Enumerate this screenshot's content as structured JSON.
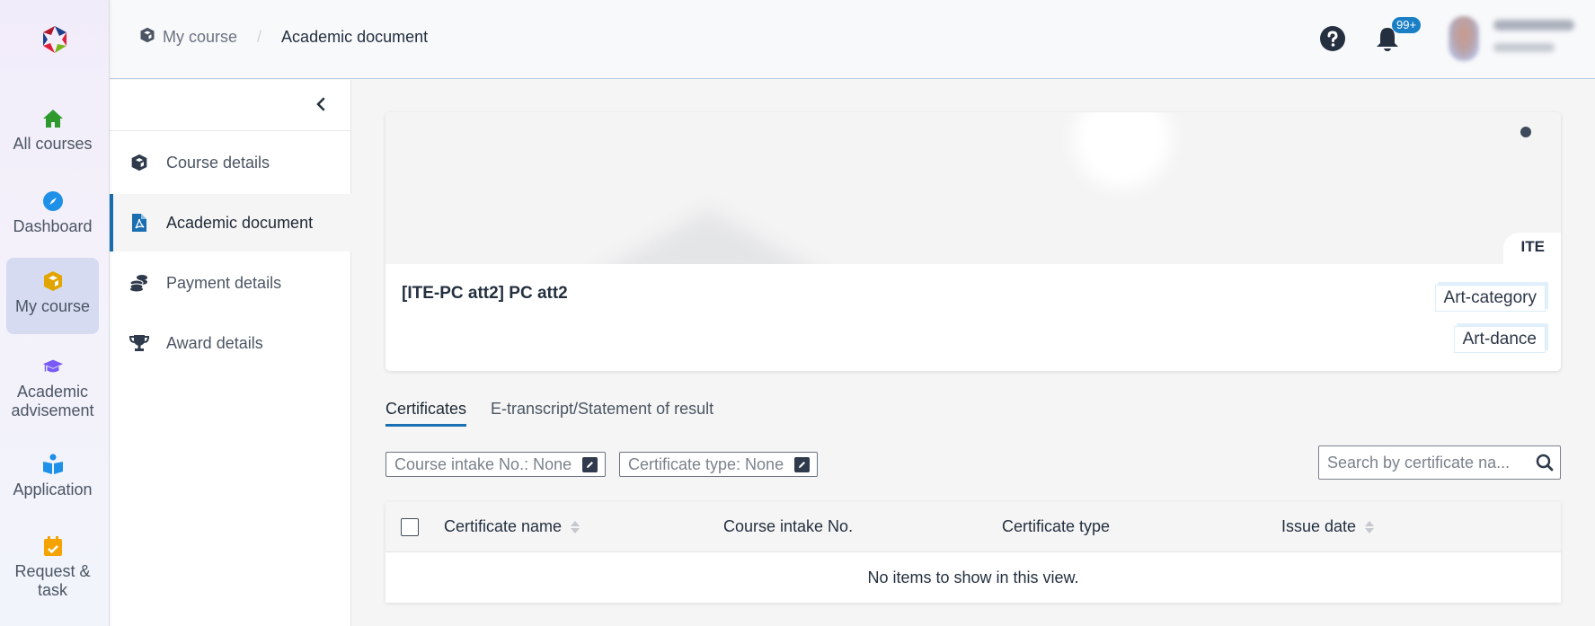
{
  "rail": {
    "logo": "app-logo",
    "items": [
      {
        "label": "All courses",
        "icon": "home-icon",
        "color": "#2e9a2e",
        "active": false
      },
      {
        "label": "Dashboard",
        "icon": "compass-icon",
        "color": "#1e90e8",
        "active": false
      },
      {
        "label": "My course",
        "icon": "cube-icon",
        "color": "#e2a500",
        "active": true
      },
      {
        "label": "Academic advisement",
        "icon": "graduation-cap-icon",
        "color": "#7a5af5",
        "active": false
      },
      {
        "label": "Application",
        "icon": "reader-icon",
        "color": "#1e90e8",
        "active": false
      },
      {
        "label": "Request & task",
        "icon": "calendar-check-icon",
        "color": "#f5a300",
        "active": false
      }
    ]
  },
  "header": {
    "breadcrumb": [
      {
        "label": "My course",
        "icon": "cube-icon"
      },
      {
        "label": "Academic document"
      }
    ],
    "separator": "/",
    "notifications_badge": "99+",
    "accent": "#1a7fc4"
  },
  "subnav": {
    "items": [
      {
        "label": "Course details",
        "icon": "cube-icon",
        "active": false
      },
      {
        "label": "Academic document",
        "icon": "pdf-file-icon",
        "active": true
      },
      {
        "label": "Payment details",
        "icon": "coins-icon",
        "active": false
      },
      {
        "label": "Award details",
        "icon": "trophy-icon",
        "active": false
      }
    ]
  },
  "course_card": {
    "org": "ITE",
    "title": "[ITE-PC att2] PC att2",
    "tags": [
      "Art-category",
      "Art-dance"
    ]
  },
  "tabs": [
    {
      "label": "Certificates",
      "active": true
    },
    {
      "label": "E-transcript/Statement of result",
      "active": false
    }
  ],
  "filters": [
    {
      "label": "Course intake No.: None"
    },
    {
      "label": "Certificate type: None"
    }
  ],
  "search": {
    "placeholder": "Search by certificate na...",
    "value": ""
  },
  "table": {
    "columns": [
      {
        "label": "Certificate name",
        "sortable": true
      },
      {
        "label": "Course intake No.",
        "sortable": false
      },
      {
        "label": "Certificate type",
        "sortable": false
      },
      {
        "label": "Issue date",
        "sortable": true
      }
    ],
    "rows": [],
    "empty_message": "No items to show in this view."
  }
}
